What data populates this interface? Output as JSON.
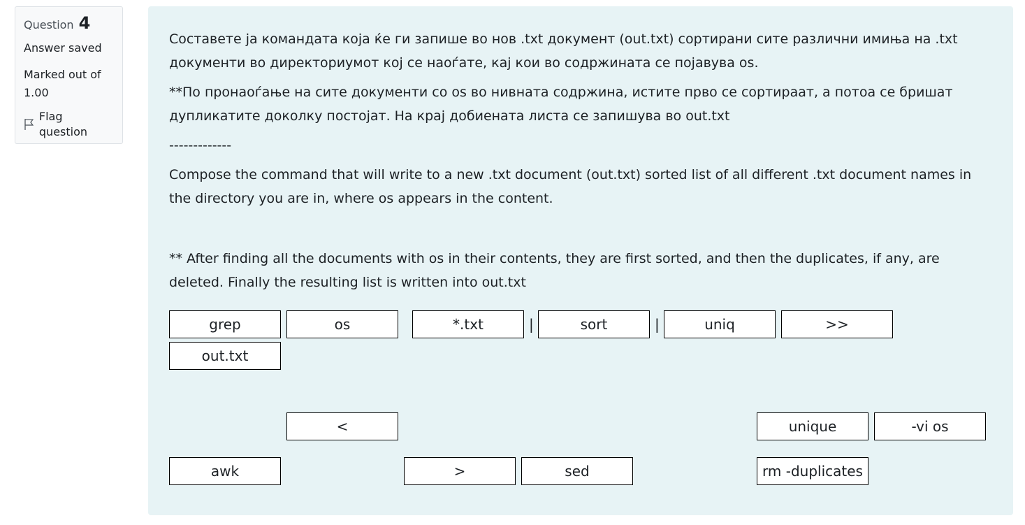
{
  "info": {
    "question_label": "Question",
    "question_number": "4",
    "state": "Answer saved",
    "grade": "Marked out of 1.00",
    "flag_label": "Flag question"
  },
  "question": {
    "paragraphs": [
      "Составете ја командата која ќе ги запише во нов .txt документ (out.txt) сортирани сите различни имиња на .txt документи во директориумот кој се наоѓате, кај кои во содржината се појавува os.",
      "**По пронаоѓање на сите документи со os во нивната содржина, истите прво се сортираат, а потоа се бришат дупликатите доколку постојат. На крај добиената листа се запишува во out.txt",
      "-------------",
      "Compose the command that will write to a new .txt document (out.txt)  sorted list of all different .txt document names in the directory you are in, where os appears in the content.",
      "** After finding all the documents with os in their contents, they are first sorted, and then the duplicates, if any, are deleted. Finally the resulting list is written into out.txt"
    ]
  },
  "answer_slots": {
    "slots": [
      "grep",
      "os",
      "*.txt",
      "sort",
      "uniq",
      ">>",
      "out.txt"
    ],
    "separators": [
      "|",
      "|"
    ]
  },
  "choices": {
    "items": [
      "<",
      "unique",
      "-vi os",
      "awk",
      ">",
      "sed",
      "rm -duplicates"
    ]
  }
}
